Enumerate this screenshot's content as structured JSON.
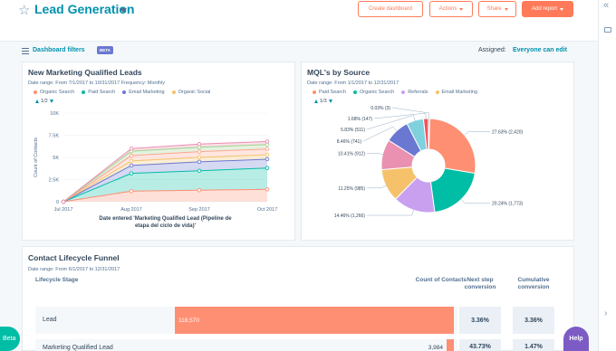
{
  "header": {
    "title": "Lead Generation",
    "buttons": {
      "create_dashboard": "Create dashboard",
      "actions": "Actions",
      "share": "Share",
      "add_report": "Add report"
    }
  },
  "filter_bar": {
    "label": "Dashboard filters",
    "badge": "BETA",
    "assigned_label": "Assigned:",
    "assigned_value": "Everyone can edit"
  },
  "mql_report": {
    "title": "New Marketing Qualified Leads",
    "meta": "Date range: From 7/1/2017 to 10/31/2017     Frequency: Monthly",
    "legend": [
      "Organic Search",
      "Paid Search",
      "Email Marketing",
      "Organic Social"
    ],
    "pager": "1/2",
    "chart_data": {
      "type": "area",
      "categories": [
        "Jul 2017",
        "Aug 2017",
        "Sep 2017",
        "Oct 2017"
      ],
      "ylabel": "Count of Contacts",
      "xlabel": "Date entered 'Marketing Qualified Lead (Pipeline de etapa del ciclo de vida)'",
      "y_ticks": [
        "0",
        "2.5K",
        "5K",
        "7.5K",
        "10K"
      ],
      "ylim": [
        0,
        10000
      ],
      "stacked": true,
      "series": [
        {
          "name": "Organic Search",
          "color": "#ff8f73",
          "values": [
            0,
            1200,
            1300,
            1400
          ]
        },
        {
          "name": "Paid Search",
          "color": "#00bda5",
          "values": [
            0,
            2000,
            2200,
            2400
          ]
        },
        {
          "name": "Email Marketing",
          "color": "#6a78d1",
          "values": [
            0,
            900,
            1000,
            1000
          ]
        },
        {
          "name": "Organic Social",
          "color": "#f5c26b",
          "values": [
            0,
            500,
            500,
            500
          ]
        },
        {
          "name": "",
          "color": "#fea58e",
          "values": [
            0,
            600,
            650,
            650
          ]
        },
        {
          "name": "",
          "color": "#a2d28f",
          "values": [
            0,
            500,
            500,
            500
          ]
        },
        {
          "name": "",
          "color": "#ea90b1",
          "values": [
            0,
            300,
            350,
            350
          ]
        }
      ]
    }
  },
  "source_report": {
    "title": "MQL's by Source",
    "meta": "Date range: From 1/1/2017 to 12/31/2017",
    "legend": [
      "Paid Search",
      "Organic Search",
      "Referrals",
      "Email Marketing"
    ],
    "pager": "1/3",
    "chart_data": {
      "type": "pie",
      "donut": true,
      "slices": [
        {
          "label": "27.63% (2,420)",
          "value": 27.63,
          "color": "#ff8f73"
        },
        {
          "label": "20.24% (1,773)",
          "value": 20.24,
          "color": "#00bda5"
        },
        {
          "label": "14.46% (1,266)",
          "value": 14.46,
          "color": "#c9a0f0"
        },
        {
          "label": "11.25% (985)",
          "value": 11.25,
          "color": "#f5c26b"
        },
        {
          "label": "10.41% (912)",
          "value": 10.41,
          "color": "#ea90b1"
        },
        {
          "label": "8.46% (741)",
          "value": 8.46,
          "color": "#6a78d1"
        },
        {
          "label": "5.83% (511)",
          "value": 5.83,
          "color": "#7fd1de"
        },
        {
          "label": "1.68% (147)",
          "value": 1.68,
          "color": "#f2545b"
        },
        {
          "label": "0.03% (3)",
          "value": 0.03,
          "color": "#7c98b6"
        }
      ]
    }
  },
  "funnel": {
    "title": "Contact Lifecycle Funnel",
    "meta": "Date range: From 6/1/2017 to 12/31/2017",
    "columns": {
      "stage": "Lifecycle Stage",
      "count": "Count of Contacts",
      "next": "Next step conversion",
      "cumulative": "Cumulative conversion"
    },
    "rows": [
      {
        "stage": "Lead",
        "count": "118,570",
        "bar_fraction": 1.0,
        "next": "3.36%",
        "cumulative": "3.36%"
      },
      {
        "stage": "Marketing Qualified Lead",
        "count": "3,984",
        "bar_fraction": 0.034,
        "next": "43.73%",
        "cumulative": "1.47%"
      }
    ]
  },
  "floating": {
    "beta": "Beta",
    "help": "Help"
  }
}
